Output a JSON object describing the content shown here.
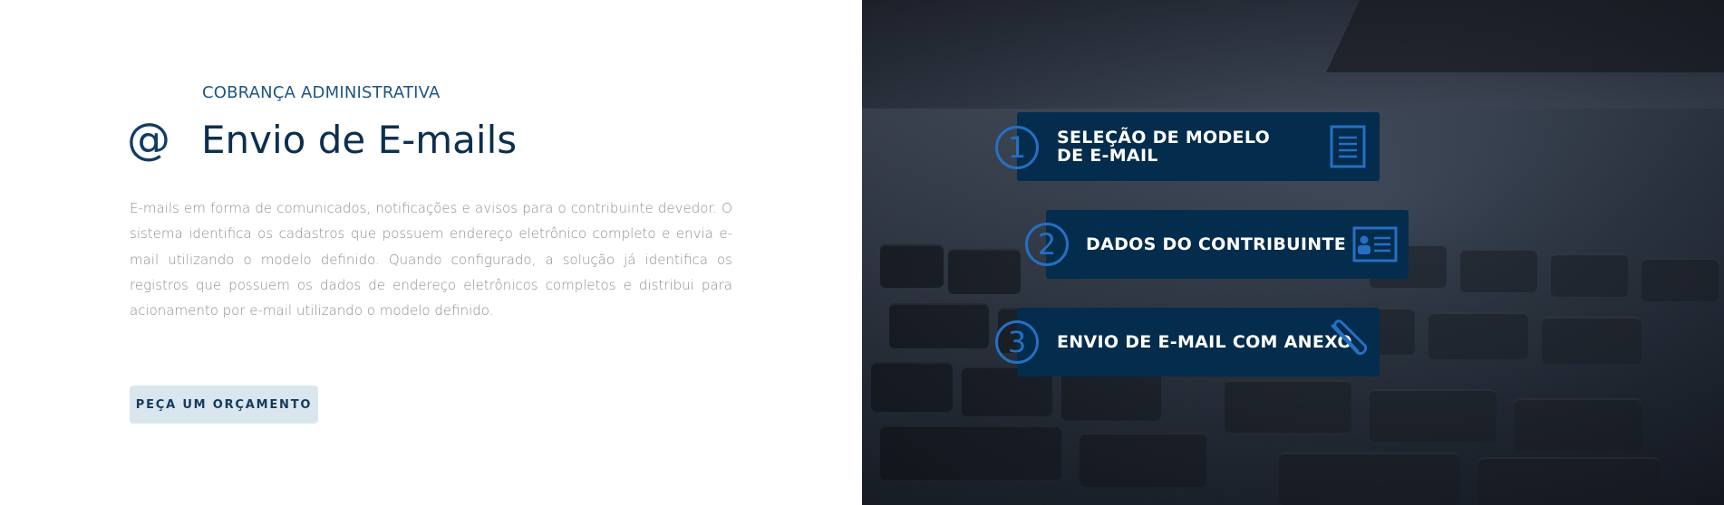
{
  "hero": {
    "icon": "at-sign-icon",
    "eyebrow": "COBRANÇA ADMINISTRATIVA",
    "title": "Envio de E-mails",
    "description": "E-mails em forma de comunicados, notificações e avisos para o contribuinte devedor. O sistema identifica os cadastros que possuem endereço eletrônico completo e envia e-mail utilizando o modelo definido. Quando configurado, a solução já identifica os registros que possuem os dados de endereço eletrônicos completos e distribui para acionamento por e-mail utilizando o modelo definido.",
    "cta_label": "PEÇA UM ORÇAMENTO"
  },
  "steps": [
    {
      "number": "1",
      "label": "SELEÇÃO DE MODELO DE E-MAIL",
      "icon": "document-icon"
    },
    {
      "number": "2",
      "label": "DADOS DO CONTRIBUINTE",
      "icon": "id-card-icon"
    },
    {
      "number": "3",
      "label": "ENVIO DE E-MAIL COM ANEXO",
      "icon": "paperclip-icon"
    }
  ],
  "colors": {
    "primary_dark": "#0c2f50",
    "accent_blue": "#2570c4",
    "step_bg": "#042c4d",
    "cta_bg": "#d9e6ee"
  }
}
